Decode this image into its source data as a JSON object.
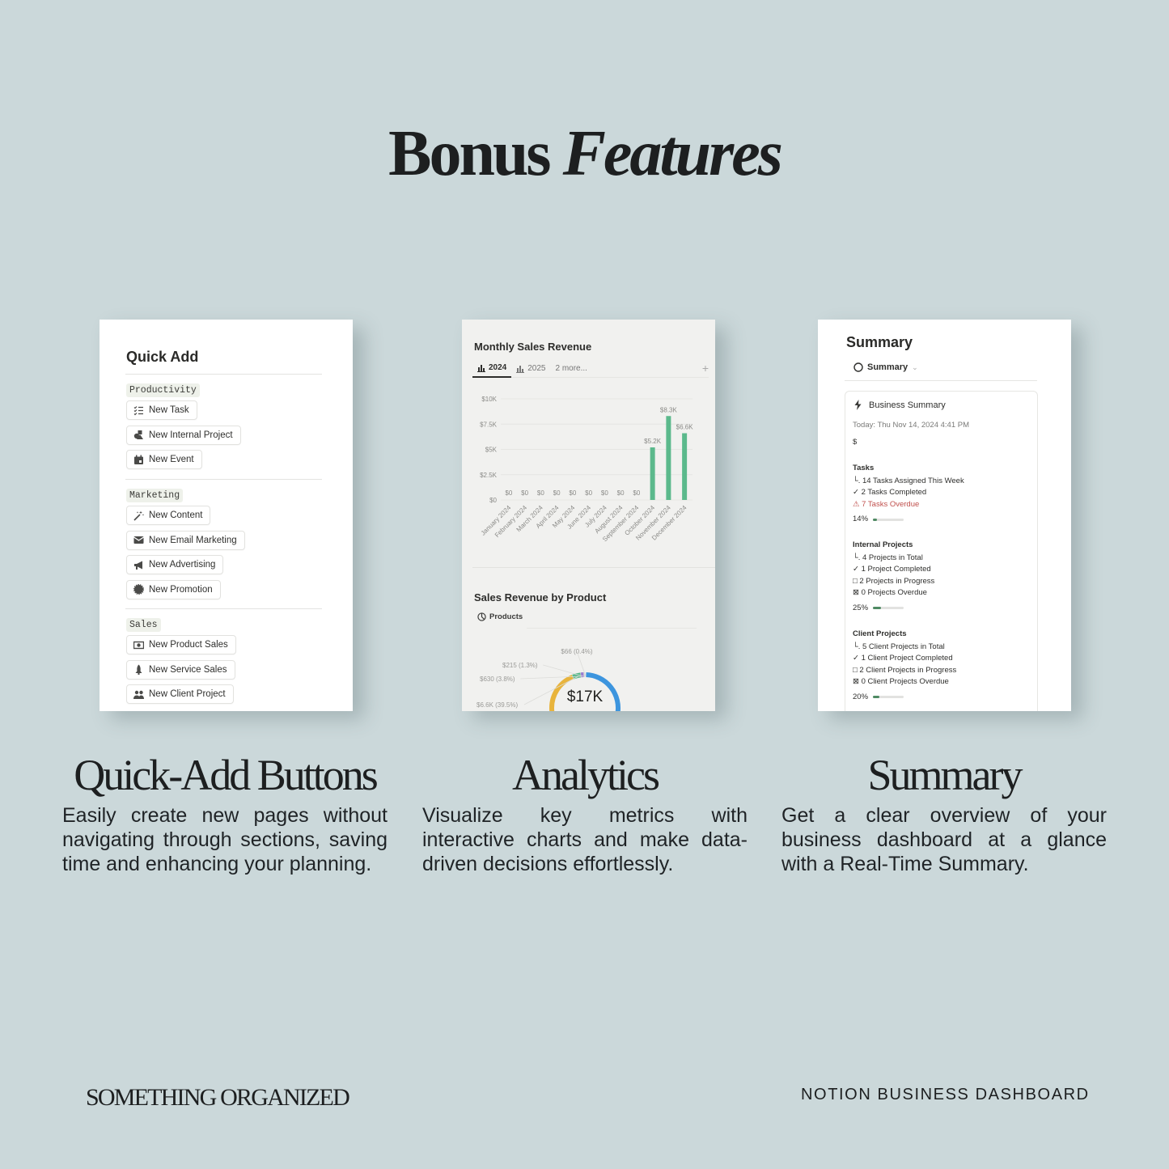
{
  "page": {
    "title_regular": "Bonus",
    "title_italic": "Features"
  },
  "quick_add": {
    "title": "Quick Add",
    "sections": [
      {
        "tag": "Productivity",
        "buttons": [
          {
            "label": "New Task",
            "icon": "checklist-icon"
          },
          {
            "label": "New Internal Project",
            "icon": "shapes-icon"
          },
          {
            "label": "New Event",
            "icon": "calendar-icon"
          }
        ]
      },
      {
        "tag": "Marketing",
        "buttons": [
          {
            "label": "New Content",
            "icon": "magic-wand-icon"
          },
          {
            "label": "New Email Marketing",
            "icon": "envelope-icon"
          },
          {
            "label": "New Advertising",
            "icon": "megaphone-icon"
          },
          {
            "label": "New Promotion",
            "icon": "badge-icon"
          }
        ]
      },
      {
        "tag": "Sales",
        "buttons": [
          {
            "label": "New Product Sales",
            "icon": "cash-icon"
          },
          {
            "label": "New Service Sales",
            "icon": "rocket-icon"
          },
          {
            "label": "New Client Project",
            "icon": "people-icon"
          }
        ]
      }
    ]
  },
  "analytics": {
    "chart1_title": "Monthly Sales Revenue",
    "tabs": [
      {
        "label": "2024",
        "active": true
      },
      {
        "label": "2025",
        "active": false
      },
      {
        "label": "2 more...",
        "active": false
      }
    ],
    "add_label": "+",
    "chart2_title": "Sales Revenue by Product",
    "chart2_view": "Products",
    "donut_center": "$17K"
  },
  "chart_data": [
    {
      "type": "bar",
      "title": "Monthly Sales Revenue",
      "categories": [
        "January 2024",
        "February 2024",
        "March 2024",
        "April 2024",
        "May 2024",
        "June 2024",
        "July 2024",
        "August 2024",
        "September 2024",
        "October 2024",
        "November 2024",
        "December 2024"
      ],
      "values": [
        0,
        0,
        0,
        0,
        0,
        0,
        0,
        0,
        0,
        5200,
        8300,
        6600
      ],
      "data_labels": [
        "$0",
        "$0",
        "$0",
        "$0",
        "$0",
        "$0",
        "$0",
        "$0",
        "$0",
        "$5.2K",
        "$8.3K",
        "$6.6K"
      ],
      "yticks": [
        "$0",
        "$2.5K",
        "$5K",
        "$7.5K",
        "$10K"
      ],
      "ylim": [
        0,
        10000
      ],
      "xlabel": "",
      "ylabel": "",
      "bar_color": "#5bb98c",
      "grid": true
    },
    {
      "type": "pie",
      "title": "Sales Revenue by Product",
      "donut": true,
      "center_label": "$17K",
      "slices": [
        {
          "label": "$6.6K (39.5%)",
          "value": 39.5,
          "color": "#e8b43c"
        },
        {
          "label": "$630 (3.8%)",
          "value": 3.8,
          "color": "#5bb98c"
        },
        {
          "label": "$215 (1.3%)",
          "value": 1.3,
          "color": "#9b7fd0"
        },
        {
          "label": "$66 (0.4%)",
          "value": 0.4,
          "color": "#d9d9d6"
        },
        {
          "label": "",
          "value": 55.0,
          "color": "#3d95de"
        }
      ]
    }
  ],
  "summary": {
    "title": "Summary",
    "view": "Summary",
    "card_title": "Business Summary",
    "today": "Today: Thu Nov 14, 2024 4:41 PM",
    "currency": "$",
    "groups": [
      {
        "title": "Tasks",
        "lines": [
          {
            "icon": "└.",
            "text": "14 Tasks Assigned This Week",
            "warn": false
          },
          {
            "icon": "✓",
            "text": "2 Tasks Completed",
            "warn": false
          },
          {
            "icon": "⚠",
            "text": "7 Tasks Overdue",
            "warn": true
          }
        ],
        "percent_label": "14%",
        "progress": 0.14
      },
      {
        "title": "Internal Projects",
        "lines": [
          {
            "icon": "└.",
            "text": "4 Projects in Total",
            "warn": false
          },
          {
            "icon": "✓",
            "text": "1 Project Completed",
            "warn": false
          },
          {
            "icon": "□",
            "text": "2 Projects in Progress",
            "warn": false
          },
          {
            "icon": "⊠",
            "text": "0 Projects Overdue",
            "warn": false
          }
        ],
        "percent_label": "25%",
        "progress": 0.25
      },
      {
        "title": "Client Projects",
        "lines": [
          {
            "icon": "└.",
            "text": "5 Client Projects in Total",
            "warn": false
          },
          {
            "icon": "✓",
            "text": "1 Client Project Completed",
            "warn": false
          },
          {
            "icon": "□",
            "text": "2 Client Projects in Progress",
            "warn": false
          },
          {
            "icon": "⊠",
            "text": "0 Client Projects Overdue",
            "warn": false
          }
        ],
        "percent_label": "20%",
        "progress": 0.2
      }
    ]
  },
  "captions": {
    "quick": {
      "heading": "Quick-Add Buttons",
      "body": "Easily create new pages without navigating through sections, saving time and enhancing your planning."
    },
    "analytics": {
      "heading": "Analytics",
      "body": "Visualize key metrics with interactive charts and make data-driven decisions effortlessly."
    },
    "summary": {
      "heading": "Summary",
      "body": "Get a clear overview of your business dashboard at a glance with a Real-Time Summary."
    }
  },
  "footer": {
    "brand": "SOMETHING ORGANIZED",
    "product": "NOTION BUSINESS DASHBOARD"
  }
}
